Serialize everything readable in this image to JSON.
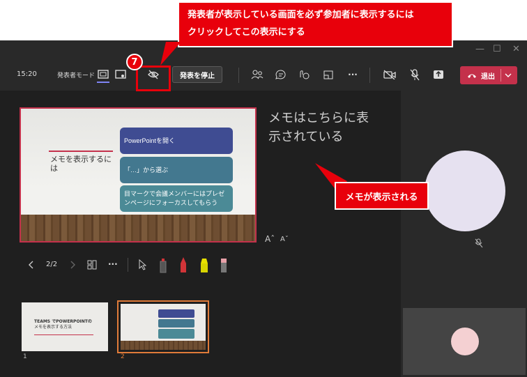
{
  "toolbar": {
    "time": "15:20",
    "presenter_mode": "発表者モード",
    "stop_presenting": "発表を停止",
    "leave": "退出"
  },
  "slide": {
    "note_title": "メモを表示するには",
    "boxes": [
      "PowerPointを開く",
      "「…」から選ぶ",
      "目マークで会議メンバーにはプレゼンページにフォーカスしてもらう"
    ]
  },
  "notes": {
    "text_line1": "メモはこちらに表",
    "text_line2": "示されている",
    "font_up": "Aˆ",
    "font_down": "Aˇ"
  },
  "controls": {
    "page": "2/2"
  },
  "thumbnails": [
    {
      "number": "1",
      "title_line1": "TEAMS でPOWERPOINTの",
      "title_line2": "メモを表示する方法"
    },
    {
      "number": "2"
    }
  ],
  "annotations": {
    "top_line1": "発表者が表示している画面を必ず参加者に表示するには",
    "top_line2": "クリックしてこの表示にする",
    "step_number": "7",
    "notes_callout": "メモが表示される"
  },
  "colors": {
    "accent": "#e8000b",
    "leave": "#c4314b",
    "thumb_selected": "#e07b39"
  }
}
